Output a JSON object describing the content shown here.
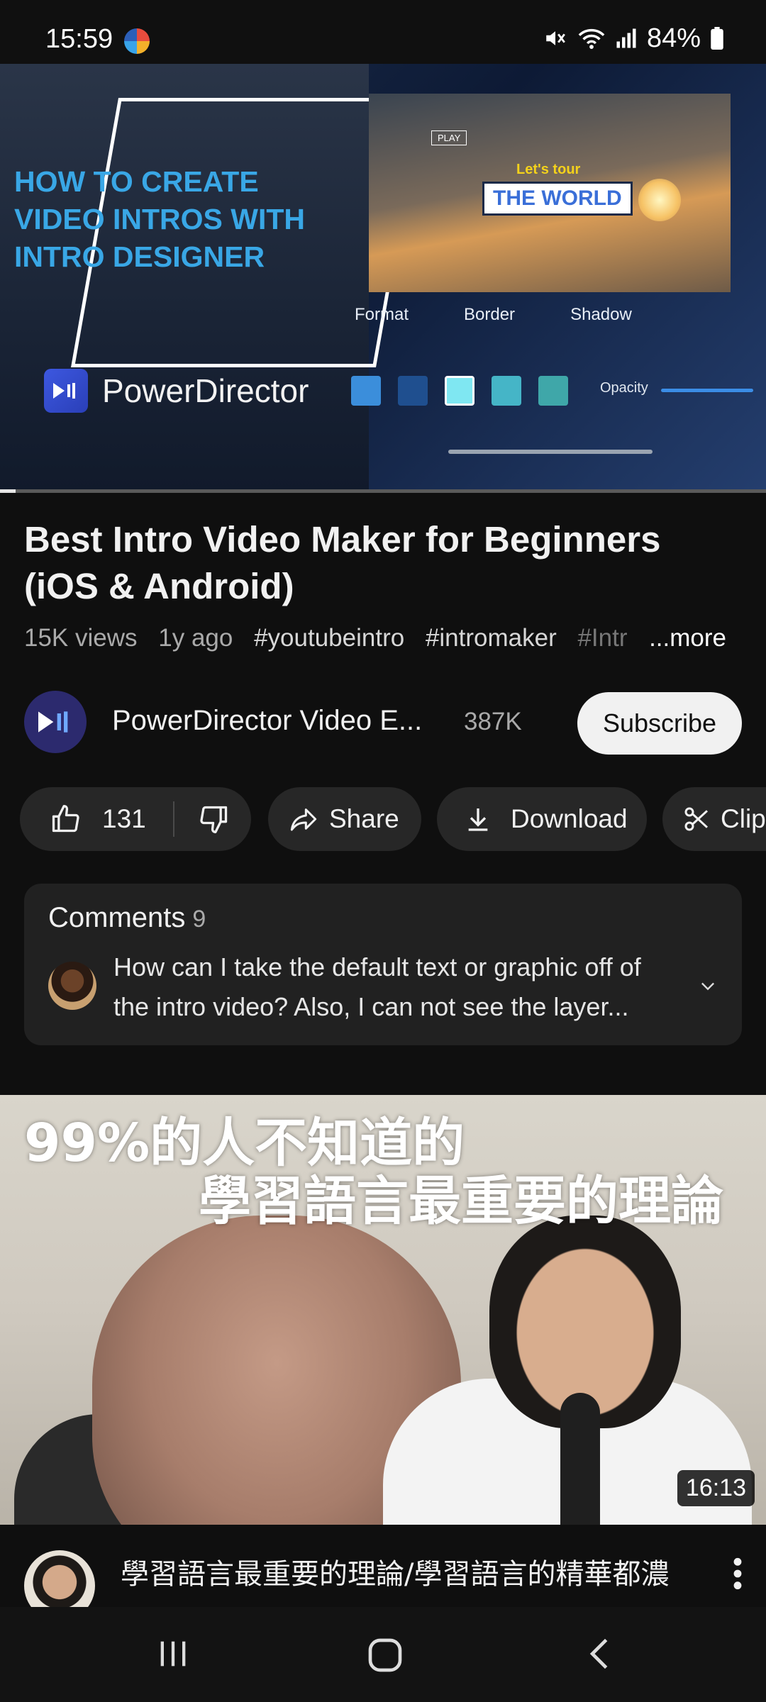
{
  "status_bar": {
    "time": "15:59",
    "battery": "84%",
    "icons": [
      "app-notification-icon",
      "mute-icon",
      "wifi-icon",
      "signal-icon",
      "battery-icon"
    ]
  },
  "video": {
    "headline": "HOW TO CREATE VIDEO INTROS WITH INTRO DESIGNER",
    "brand": "PowerDirector",
    "preview_badge": "PLAY",
    "preview_small_text": "Let's tour",
    "preview_big_text": "THE WORLD",
    "panel_tabs": [
      "Format",
      "Border",
      "Shadow"
    ],
    "opacity_label": "Opacity",
    "swatch_colors": [
      "#3b8edb",
      "#1f4f8f",
      "#7fe7f2",
      "#45b5c7",
      "#3fa7a9"
    ],
    "progress": 0.02
  },
  "title": "Best Intro Video Maker for Beginners (iOS & Android)",
  "meta": {
    "views": "15K views",
    "age": "1y ago",
    "tags": [
      "#youtubeintro",
      "#intromaker",
      "#Intr"
    ],
    "more": "...more"
  },
  "channel": {
    "name": "PowerDirector Video E...",
    "subscribers": "387K",
    "subscribe_label": "Subscribe"
  },
  "actions": {
    "likes": "131",
    "share": "Share",
    "download": "Download",
    "clip": "Clip"
  },
  "comments": {
    "title": "Comments",
    "count": "9",
    "preview": "How can I take the default text or graphic off of the intro video? Also, I can not see the layer..."
  },
  "next_video": {
    "thumb_line1": "99%的人不知道的",
    "thumb_line2": "學習語言最重要的理論",
    "duration": "16:13",
    "title": "學習語言最重要的理論/學習語言的精華都濃"
  },
  "colors": {
    "background": "#0f0f0f",
    "chip": "#272727",
    "card": "#212121",
    "headline_blue": "#39a7e6"
  }
}
